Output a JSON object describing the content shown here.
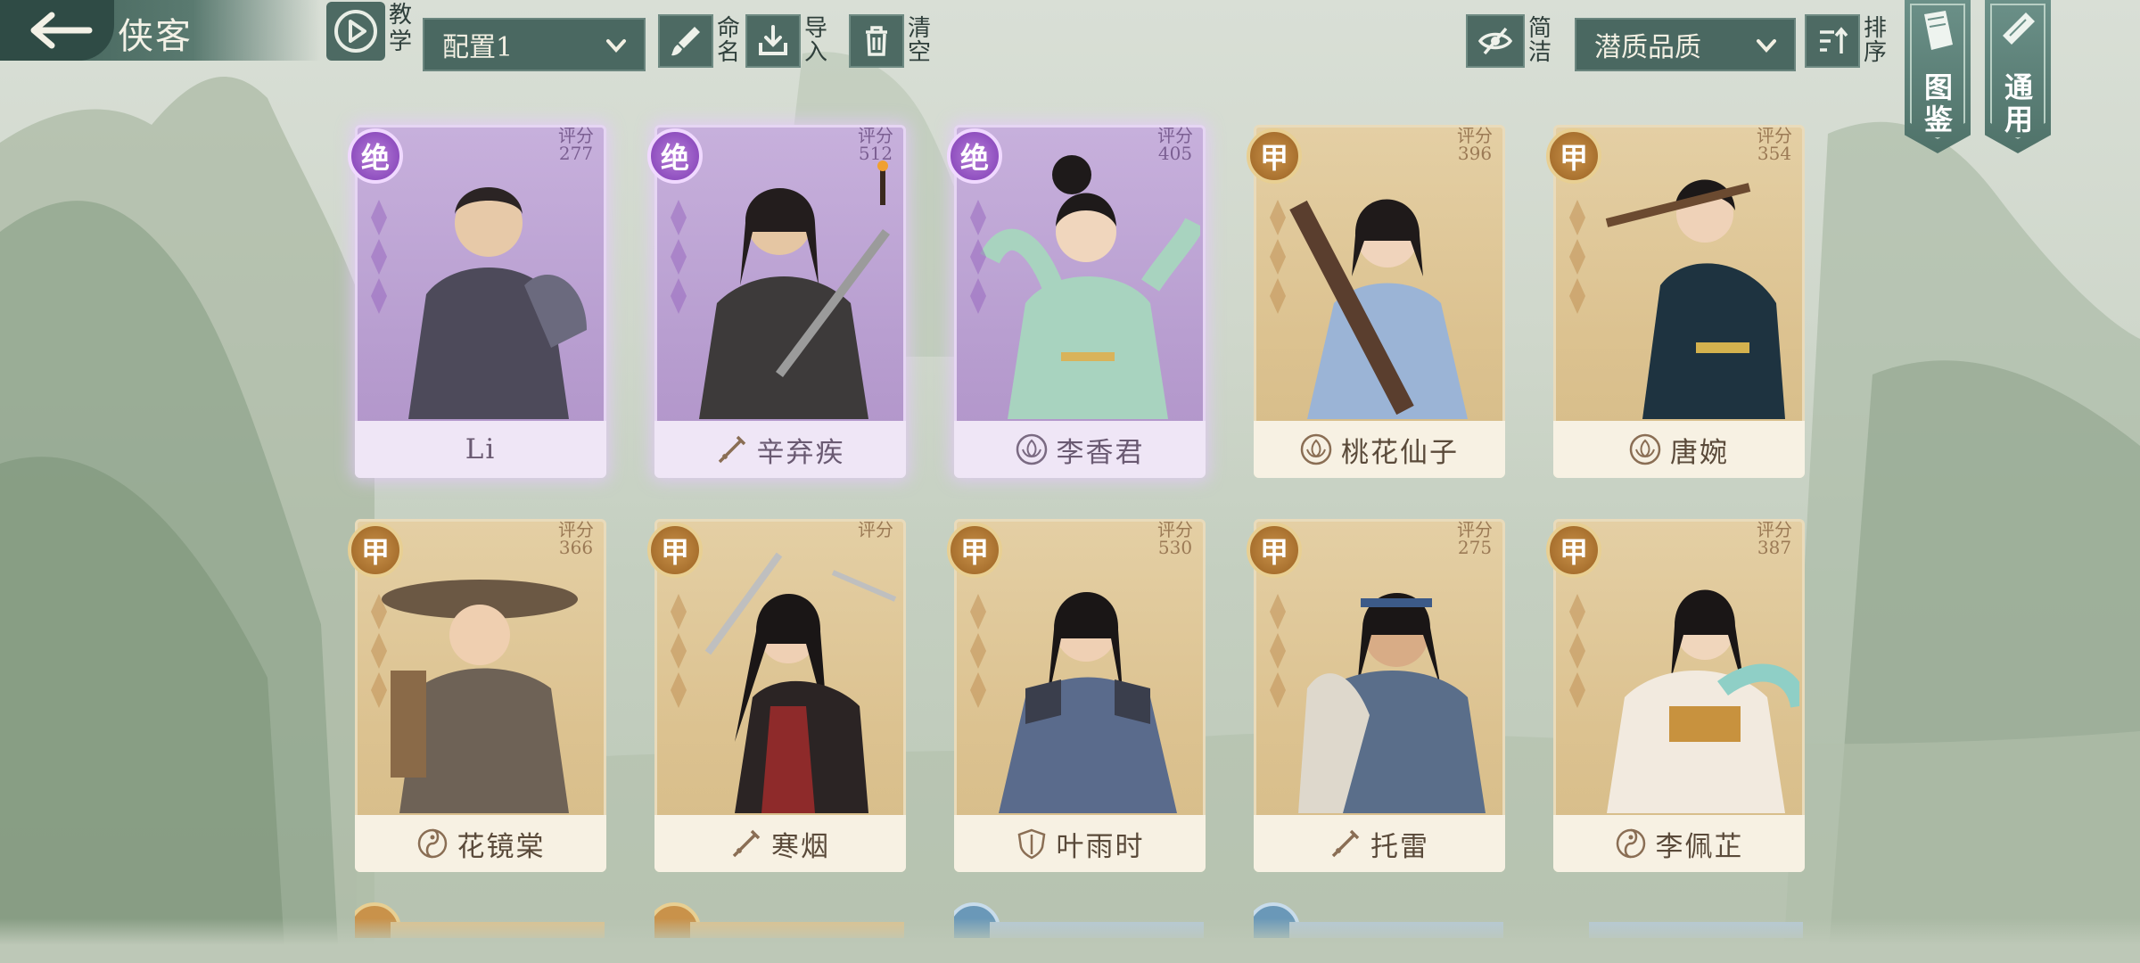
{
  "header": {
    "title": "侠客",
    "tutorial_label": "教学",
    "config_select": "配置1",
    "rename_label": "命名",
    "import_label": "导入",
    "clear_label": "清空",
    "simple_label": "简洁",
    "sort_select": "潜质品质",
    "sort_label": "排序",
    "atlas_label": "图鉴",
    "general_label": "通用"
  },
  "colors": {
    "gold_card": "#dcc290",
    "purple_card": "#b89ed0",
    "toolbar": "#4a6861"
  },
  "score_label": "评分",
  "cards": [
    {
      "name": "Li",
      "score": "277",
      "rank": "绝",
      "tier": "purple",
      "class_icon": "none"
    },
    {
      "name": "辛弃疾",
      "score": "512",
      "rank": "绝",
      "tier": "purple",
      "class_icon": "sword-icon"
    },
    {
      "name": "李香君",
      "score": "405",
      "rank": "绝",
      "tier": "purple",
      "class_icon": "lotus-icon"
    },
    {
      "name": "桃花仙子",
      "score": "396",
      "rank": "甲",
      "tier": "gold",
      "class_icon": "lotus-icon"
    },
    {
      "name": "唐婉",
      "score": "354",
      "rank": "甲",
      "tier": "gold",
      "class_icon": "lotus-icon"
    },
    {
      "name": "花镜棠",
      "score": "366",
      "rank": "甲",
      "tier": "gold",
      "class_icon": "taiji-icon"
    },
    {
      "name": "寒烟",
      "score": "",
      "rank": "甲",
      "tier": "gold",
      "class_icon": "sword-icon"
    },
    {
      "name": "叶雨时",
      "score": "530",
      "rank": "甲",
      "tier": "gold",
      "class_icon": "shield-icon"
    },
    {
      "name": "托雷",
      "score": "275",
      "rank": "甲",
      "tier": "gold",
      "class_icon": "sword-icon"
    },
    {
      "name": "李佩芷",
      "score": "387",
      "rank": "甲",
      "tier": "gold",
      "class_icon": "taiji-icon"
    }
  ]
}
